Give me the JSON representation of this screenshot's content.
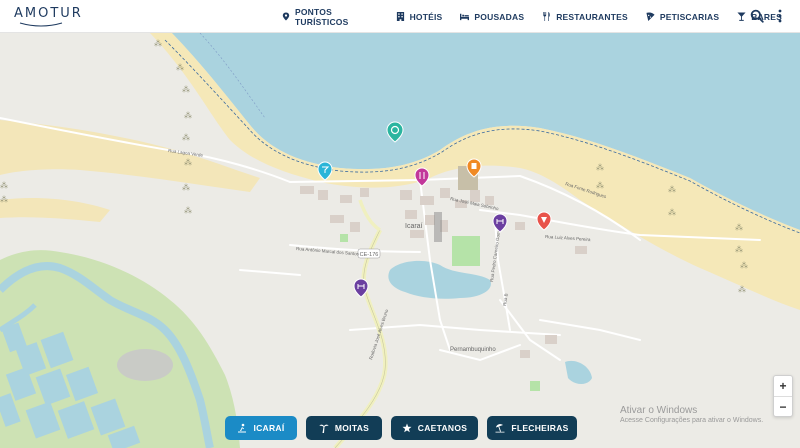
{
  "app": {
    "logo_text": "AMOTUR"
  },
  "nav": {
    "items": [
      {
        "label": "PONTOS TURÍSTICOS",
        "icon": "map-pin-icon"
      },
      {
        "label": "HOTÉIS",
        "icon": "hotel-icon"
      },
      {
        "label": "POUSADAS",
        "icon": "bed-icon"
      },
      {
        "label": "RESTAURANTES",
        "icon": "cutlery-icon"
      },
      {
        "label": "PETISCARIAS",
        "icon": "pizza-slice-icon"
      },
      {
        "label": "BARES",
        "icon": "cocktail-icon"
      }
    ]
  },
  "map": {
    "town_label": "Icaraí",
    "neighborhood_label": "Pernambuquinho",
    "roads": [
      "Rua Lagoa Verde",
      "Rua Antônio Marcal dos Santos",
      "CE-176",
      "Rodovia José Alves Bruno",
      "Rua Luiz Alves Pereira",
      "Rua Pedro Carneiro Gomes",
      "Rua B",
      "Rua José Maia Sobrinho",
      "Rua Fonte Rodrigues"
    ],
    "markers": [
      {
        "type": "tourist-spot",
        "color": "#2bb5a0"
      },
      {
        "type": "bar",
        "color": "#2bb5d8"
      },
      {
        "type": "restaurant",
        "color": "#c2379a"
      },
      {
        "type": "hotel",
        "color": "#f08a24"
      },
      {
        "type": "pousada",
        "color": "#6b3fa0"
      },
      {
        "type": "pousada",
        "color": "#6b3fa0"
      },
      {
        "type": "petiscaria",
        "color": "#e8534a"
      }
    ]
  },
  "zoom": {
    "in": "+",
    "out": "−"
  },
  "bottom_buttons": [
    {
      "label": "ICARAÍ",
      "icon": "beach-person-icon",
      "active": true
    },
    {
      "label": "MOITAS",
      "icon": "palm-tree-icon",
      "active": false
    },
    {
      "label": "CAETANOS",
      "icon": "starfish-icon",
      "active": false
    },
    {
      "label": "FLECHEIRAS",
      "icon": "beach-umbrella-icon",
      "active": false
    }
  ],
  "watermark": {
    "title": "Ativar o Windows",
    "subtitle": "Acesse Configurações para ativar o Windows."
  }
}
